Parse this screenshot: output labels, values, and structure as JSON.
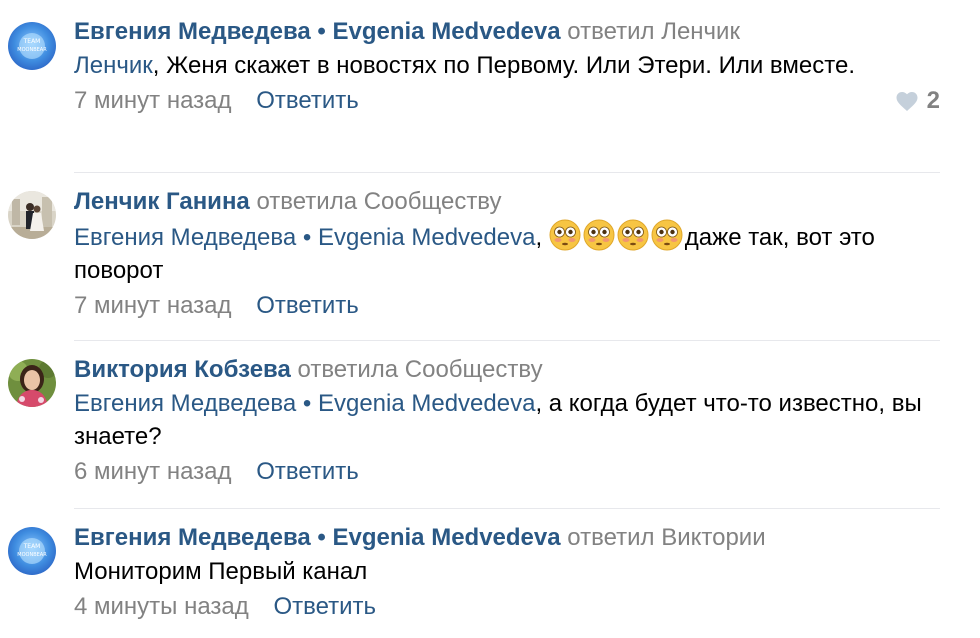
{
  "comments": [
    {
      "author": "Евгения Медведева • Evgenia Medvedeva",
      "reply_to": "ответил Ленчик",
      "mention": "Ленчик",
      "text": ", Женя скажет в новостях по Первому. Или Этери. Или вместе.",
      "time": "7 минут назад",
      "reply_label": "Ответить",
      "likes": "2"
    },
    {
      "author": "Ленчик Ганина",
      "reply_to": "ответила Сообществу",
      "mention": "Евгения Медведева • Evgenia Medvedeva",
      "text_before_emoji": ", ",
      "emoji": [
        "flushed-face",
        "flushed-face",
        "flushed-face",
        "flushed-face"
      ],
      "text": "даже так, вот это поворот",
      "time": "7 минут назад",
      "reply_label": "Ответить"
    },
    {
      "author": "Виктория Кобзева",
      "reply_to": "ответила Сообществу",
      "mention": "Евгения Медведева • Evgenia Medvedeva",
      "text": ", а когда будет что-то известно, вы знаете?",
      "time": "6 минут назад",
      "reply_label": "Ответить"
    },
    {
      "author": "Евгения Медведева • Evgenia Medvedeva",
      "reply_to": "ответил Виктории",
      "text": "Мониторим Первый канал",
      "time": "4 минуты назад",
      "reply_label": "Ответить"
    }
  ],
  "avatar_logo_text": [
    "TEAM",
    "MOONBEAR"
  ],
  "colors": {
    "link": "#2a5885",
    "muted": "#828282",
    "divider": "#e7e8ec",
    "heart": "#c5d0db"
  }
}
